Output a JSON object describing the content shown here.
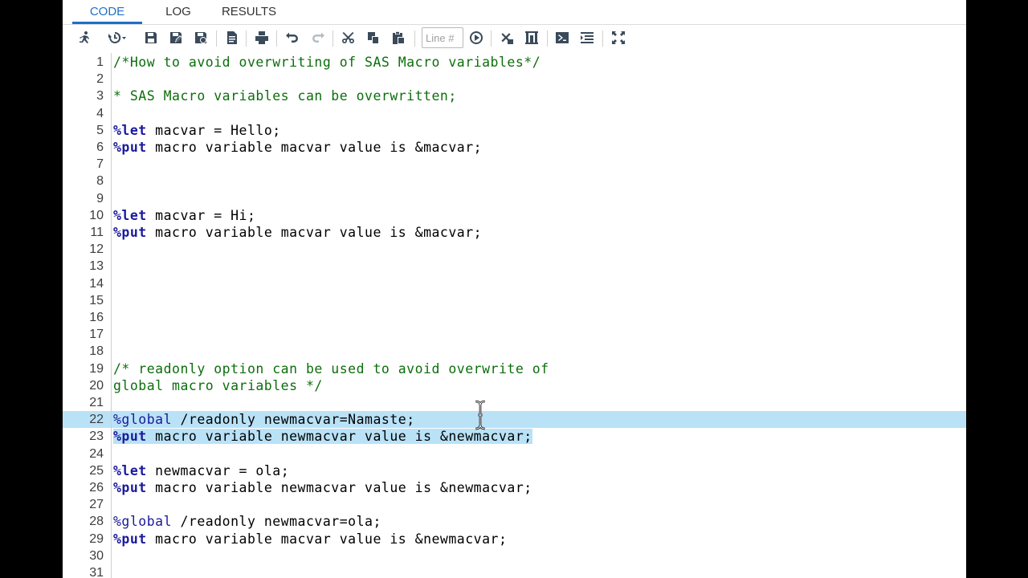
{
  "tabs": [
    "CODE",
    "LOG",
    "RESULTS"
  ],
  "toolbar": {
    "line_placeholder": "Line #",
    "icons": [
      "run-icon",
      "history-icon",
      "save-icon",
      "save-as-icon",
      "save-copy-icon",
      "export-icon",
      "print-icon",
      "undo-icon",
      "redo-icon",
      "cut-icon",
      "copy-icon",
      "paste-icon",
      "go-to-line-icon",
      "clear-icon",
      "format-icon",
      "submit-icon",
      "snippet-icon",
      "maximize-icon"
    ]
  },
  "accent_color": "#1f6fc6",
  "selection_color": "#b9e2f7",
  "lines": [
    {
      "n": "1",
      "text": "/*How to avoid overwriting of SAS Macro variables*/"
    },
    {
      "n": "2",
      "text": ""
    },
    {
      "n": "3",
      "text": "* SAS Macro variables can be overwritten;"
    },
    {
      "n": "4",
      "text": ""
    },
    {
      "n": "5",
      "kw": "%let",
      "text": " macvar = Hello;"
    },
    {
      "n": "6",
      "kw": "%put",
      "text": " macro variable macvar value is &macvar;"
    },
    {
      "n": "7",
      "text": ""
    },
    {
      "n": "8",
      "text": ""
    },
    {
      "n": "9",
      "text": ""
    },
    {
      "n": "10",
      "kw": "%let",
      "text": " macvar = Hi;"
    },
    {
      "n": "11",
      "kw": "%put",
      "text": " macro variable macvar value is &macvar;"
    },
    {
      "n": "12",
      "text": ""
    },
    {
      "n": "13",
      "text": ""
    },
    {
      "n": "14",
      "text": ""
    },
    {
      "n": "15",
      "text": ""
    },
    {
      "n": "16",
      "text": ""
    },
    {
      "n": "17",
      "text": ""
    },
    {
      "n": "18",
      "text": ""
    },
    {
      "n": "19",
      "text": "/* readonly option can be used to avoid overwrite of"
    },
    {
      "n": "20",
      "text": "global macro variables */"
    },
    {
      "n": "21",
      "text": ""
    },
    {
      "n": "22",
      "kw": "%global",
      "text": " /readonly newmacvar=Namaste;"
    },
    {
      "n": "23",
      "kw": "%put",
      "text": " macro variable newmacvar value is &newmacvar;"
    },
    {
      "n": "24",
      "text": ""
    },
    {
      "n": "25",
      "kw": "%let",
      "text": " newmacvar = ola;"
    },
    {
      "n": "26",
      "kw": "%put",
      "text": " macro variable newmacvar value is &newmacvar;"
    },
    {
      "n": "27",
      "text": ""
    },
    {
      "n": "28",
      "kw": "%global",
      "text": " /readonly newmacvar=ola;"
    },
    {
      "n": "29",
      "kw": "%put",
      "text": " macro variable macvar value is &newmacvar;"
    },
    {
      "n": "30",
      "text": ""
    },
    {
      "n": "31",
      "text": ""
    }
  ]
}
